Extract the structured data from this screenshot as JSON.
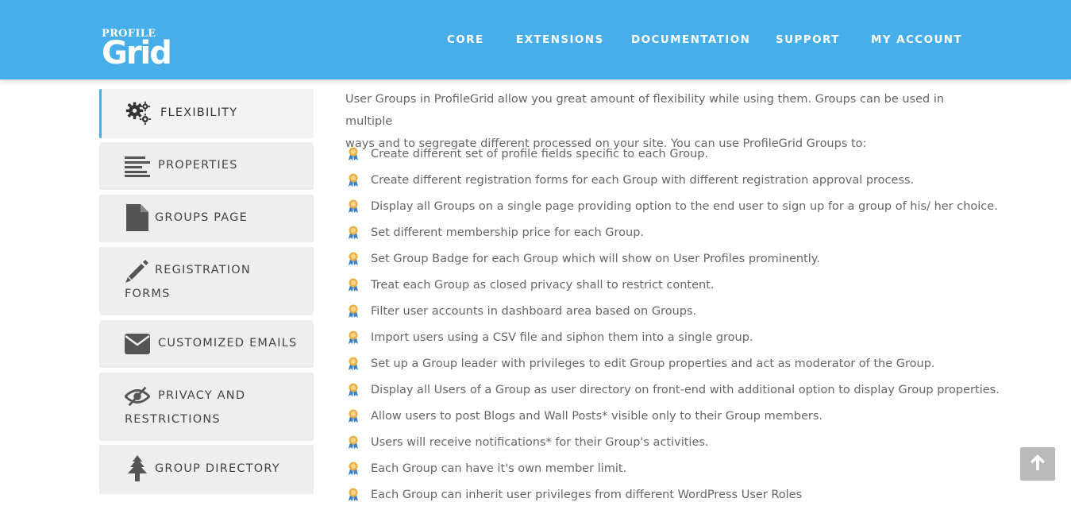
{
  "logo": {
    "top_text": "PROFILE",
    "main_text": "Grid"
  },
  "nav": [
    "CORE",
    "EXTENSIONS",
    "DOCUMENTATION",
    "SUPPORT",
    "MY ACCOUNT"
  ],
  "sidebar": {
    "items": [
      {
        "label": "FLEXIBILITY",
        "icon": "gears-icon",
        "active": true
      },
      {
        "label": "PROPERTIES",
        "icon": "align-left-icon",
        "active": false
      },
      {
        "label": "GROUPS PAGE",
        "icon": "file-icon",
        "active": false
      },
      {
        "label_line1": "REGISTRATION",
        "label_line2": "FORMS",
        "icon": "pencil-icon",
        "active": false
      },
      {
        "label": "CUSTOMIZED EMAILS",
        "icon": "envelope-icon",
        "active": false
      },
      {
        "label_line1": "PRIVACY AND",
        "label_line2": "RESTRICTIONS",
        "icon": "eye-slash-icon",
        "active": false
      },
      {
        "label": "GROUP DIRECTORY",
        "icon": "tree-icon",
        "active": false
      }
    ]
  },
  "content": {
    "intro_line1": "User Groups in ProfileGrid allow you great amount of flexibility while using them. Groups can be used in multiple",
    "intro_line2": "ways and to segregate different processed on your site. You can use ProfileGrid Groups to:",
    "features": [
      "Create different set of profile fields specific to each Group.",
      "Create different registration forms for each Group with different registration approval process.",
      "Display all Groups on a single page providing option to the end user to sign up for a group of his/ her choice.",
      "Set different membership price for each Group.",
      "Set Group Badge for each Group which will show on User Profiles prominently.",
      "Treat each Group as closed privacy shall to restrict content.",
      "Filter user accounts in dashboard area based on Groups.",
      "Import users using a CSV file and siphon them into a single group.",
      "Set up a Group leader with privileges to edit Group properties and act as moderator of the Group.",
      "Display all Users of a Group as user directory on front-end with additional option to display Group properties.",
      "Allow users to post Blogs and Wall Posts* visible only to their Group members.",
      "Users will receive notifications* for their Group's activities.",
      "Each Group can have it's own member limit.",
      "Each Group can inherit user privileges from different WordPress User Roles"
    ]
  },
  "colors": {
    "header": "#47aee9",
    "sidebar_bg": "#eeeeee",
    "text": "#666666",
    "medal_gold": "#e7b04a",
    "medal_ribbon": "#3b82c4"
  },
  "back_to_top_icon": "arrow-up-icon"
}
